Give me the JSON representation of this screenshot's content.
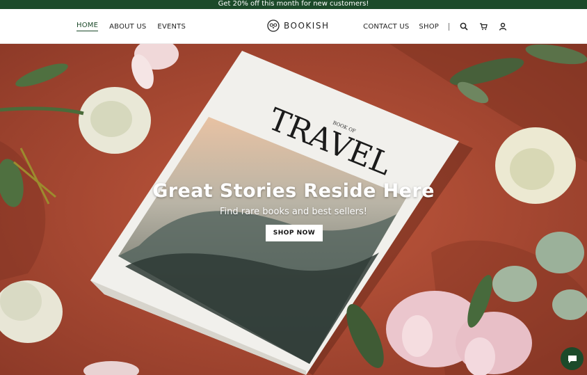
{
  "announcement": {
    "text": "Get 20% off this month for new customers!"
  },
  "nav": {
    "left": [
      {
        "label": "HOME",
        "active": true
      },
      {
        "label": "ABOUT US"
      },
      {
        "label": "EVENTS"
      }
    ],
    "right": [
      {
        "label": "CONTACT US"
      },
      {
        "label": "SHOP"
      }
    ],
    "icons": [
      "search-icon",
      "cart-icon",
      "user-icon"
    ]
  },
  "logo": {
    "text": "BOOKISH",
    "icon": "owl-icon"
  },
  "hero": {
    "title": "Great Stories Reside Here",
    "subtitle": "Find rare books and best sellers!",
    "button": "SHOP NOW",
    "book_small": "BOOK OF",
    "book_title": "TRAVEL"
  },
  "chat": {
    "icon": "chat-icon"
  },
  "colors": {
    "brand": "#1c4a2a",
    "background": "#b3523a"
  }
}
